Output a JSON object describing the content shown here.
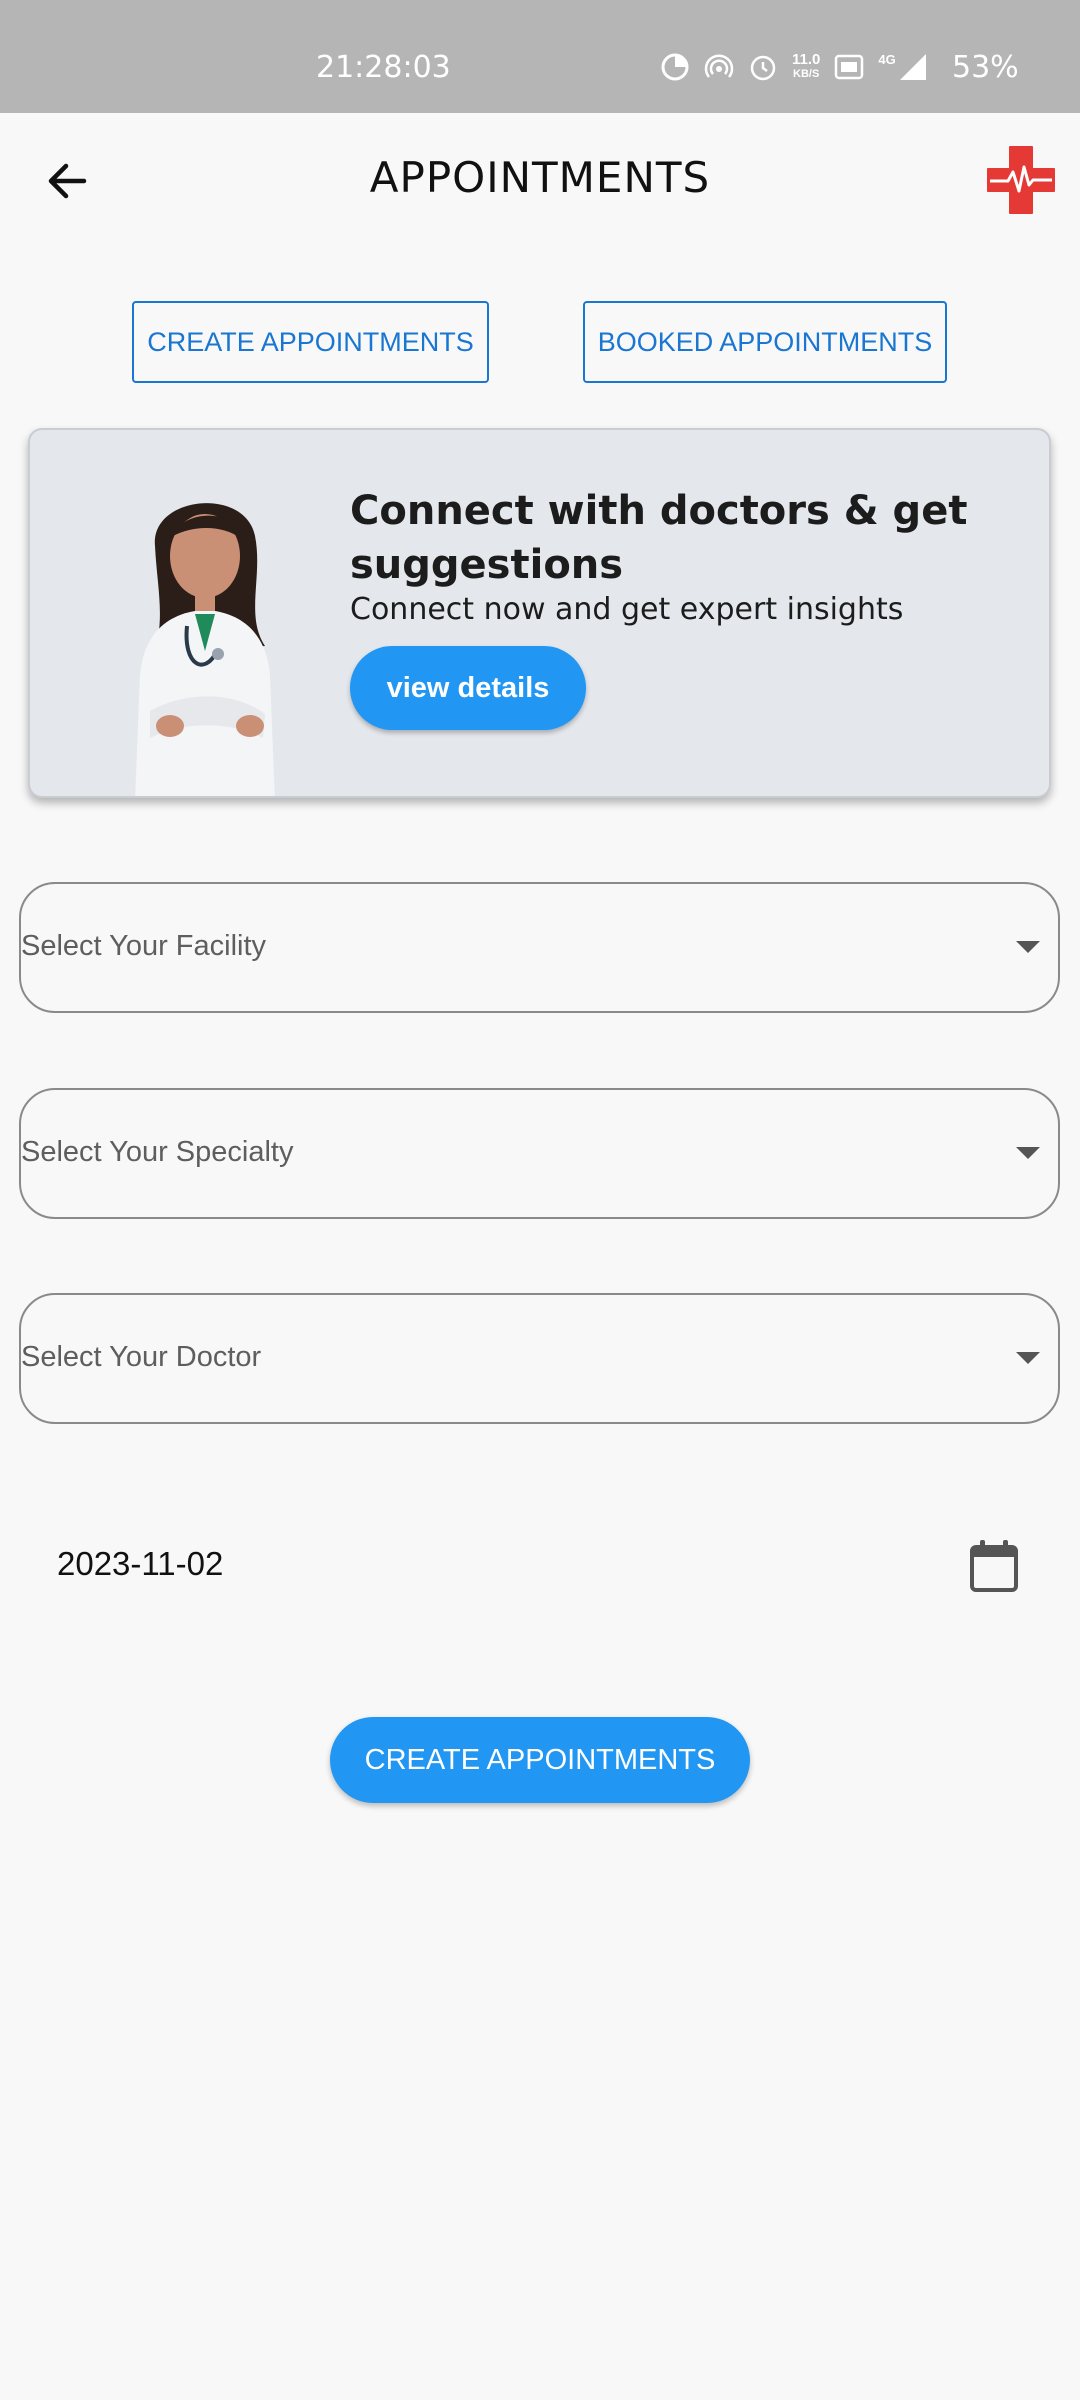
{
  "status_bar": {
    "time": "21:28:03",
    "battery": "53%",
    "icons": [
      "data-saver-icon",
      "hotspot-icon",
      "alarm-icon",
      "network-speed-icon",
      "volte-icon",
      "signal-4g-icon"
    ],
    "network_speed": "11.0",
    "network_unit": "KB/S",
    "network_type": "4G"
  },
  "app_bar": {
    "title": "APPOINTMENTS",
    "back_icon": "arrow-left-icon",
    "logo_icon": "medical-cross-logo"
  },
  "tabs": {
    "create_label": "CREATE APPOINTMENTS",
    "booked_label": "BOOKED APPOINTMENTS"
  },
  "promo_card": {
    "title": "Connect with doctors & get suggestions",
    "subtitle": "Connect now and get expert insights",
    "button_label": "view details"
  },
  "form": {
    "facility_placeholder": "Select Your Facility",
    "specialty_placeholder": "Select Your Specialty",
    "doctor_placeholder": "Select Your Doctor",
    "date_value": "2023-11-02",
    "submit_label": "CREATE APPOINTMENTS"
  },
  "colors": {
    "accent": "#2196f3",
    "outline_accent": "#1976d2",
    "logo_red": "#e53935",
    "status_bar": "#b5b5b5"
  }
}
